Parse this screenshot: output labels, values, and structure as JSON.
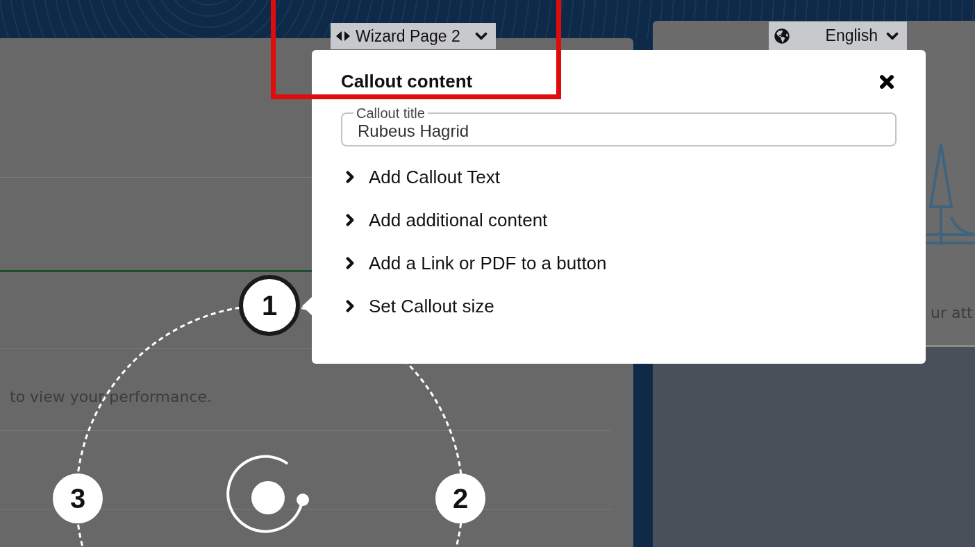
{
  "wizard_page": {
    "label": "Wizard Page 2"
  },
  "language": {
    "label": "English"
  },
  "background_texts": [
    {
      "kind": "left",
      "text": "to view your performance."
    },
    {
      "kind": "right",
      "text": "ur att"
    }
  ],
  "callout": {
    "title": "Callout content",
    "field": {
      "label": "Callout title",
      "value": "Rubeus Hagrid"
    },
    "sections": [
      {
        "label": "Add Callout Text",
        "expanded": false
      },
      {
        "label": "Add additional content",
        "expanded": false
      },
      {
        "label": "Add a Link or PDF to a button",
        "expanded": false
      },
      {
        "label": "Set Callout size",
        "expanded": false
      }
    ]
  },
  "nodes": [
    {
      "label": "1",
      "selected": true
    },
    {
      "label": "2",
      "selected": false
    },
    {
      "label": "3",
      "selected": false
    }
  ]
}
